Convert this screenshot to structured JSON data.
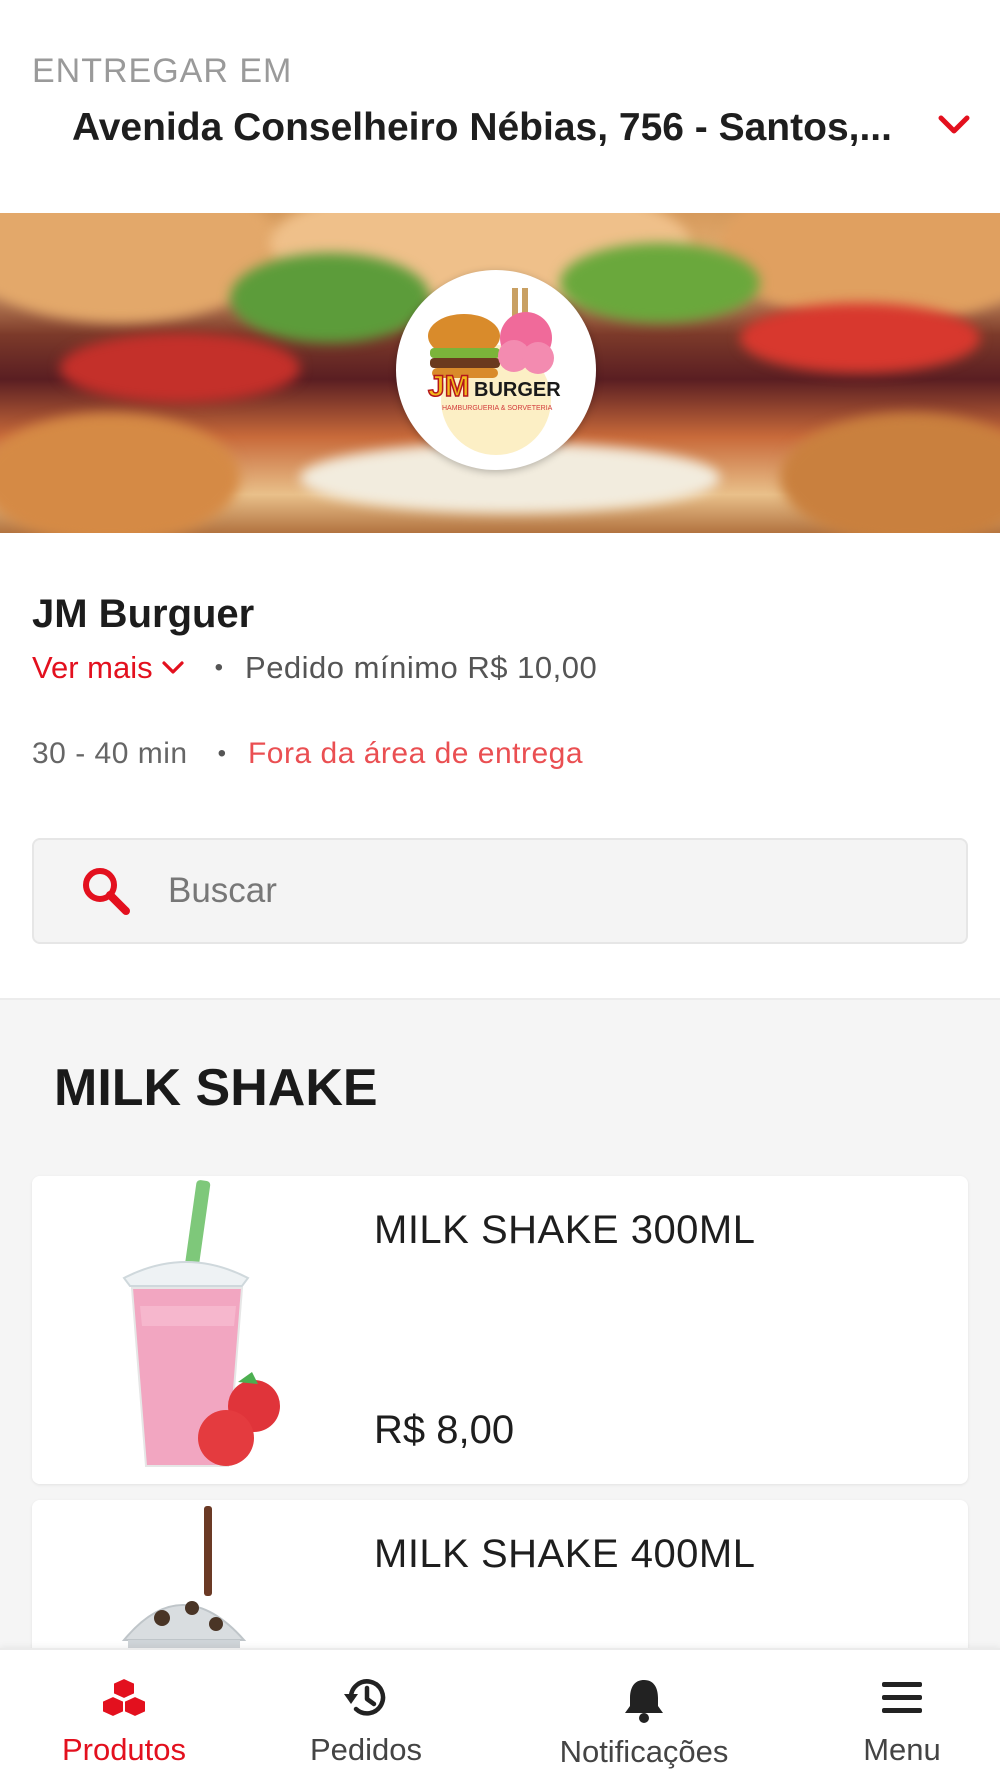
{
  "header": {
    "deliver_label": "ENTREGAR EM",
    "address": "Avenida Conselheiro Nébias, 756 - Santos,..."
  },
  "store": {
    "name": "JM Burguer",
    "logo_text": "JM BURGER",
    "logo_subtext": "HAMBURGUERIA & SORVETERIA",
    "ver_mais": "Ver mais",
    "separator": "•",
    "min_order": "Pedido mínimo R$ 10,00",
    "delivery_time": "30 - 40 min",
    "delivery_status": "Fora da área de entrega"
  },
  "search": {
    "placeholder": "Buscar"
  },
  "category": {
    "title": "MILK SHAKE",
    "products": [
      {
        "name": "MILK SHAKE 300ML",
        "price": "R$ 8,00"
      },
      {
        "name": "MILK SHAKE 400ML",
        "price": ""
      }
    ]
  },
  "nav": {
    "items": [
      {
        "label": "Produtos",
        "icon": "cubes-icon",
        "active": true
      },
      {
        "label": "Pedidos",
        "icon": "history-icon",
        "active": false
      },
      {
        "label": "Notificações",
        "icon": "bell-icon",
        "active": false
      },
      {
        "label": "Menu",
        "icon": "hamburger-menu-icon",
        "active": false
      }
    ]
  },
  "colors": {
    "accent": "#e3101e",
    "warning_text": "#ea4f52",
    "background_section": "#f5f5f5"
  }
}
